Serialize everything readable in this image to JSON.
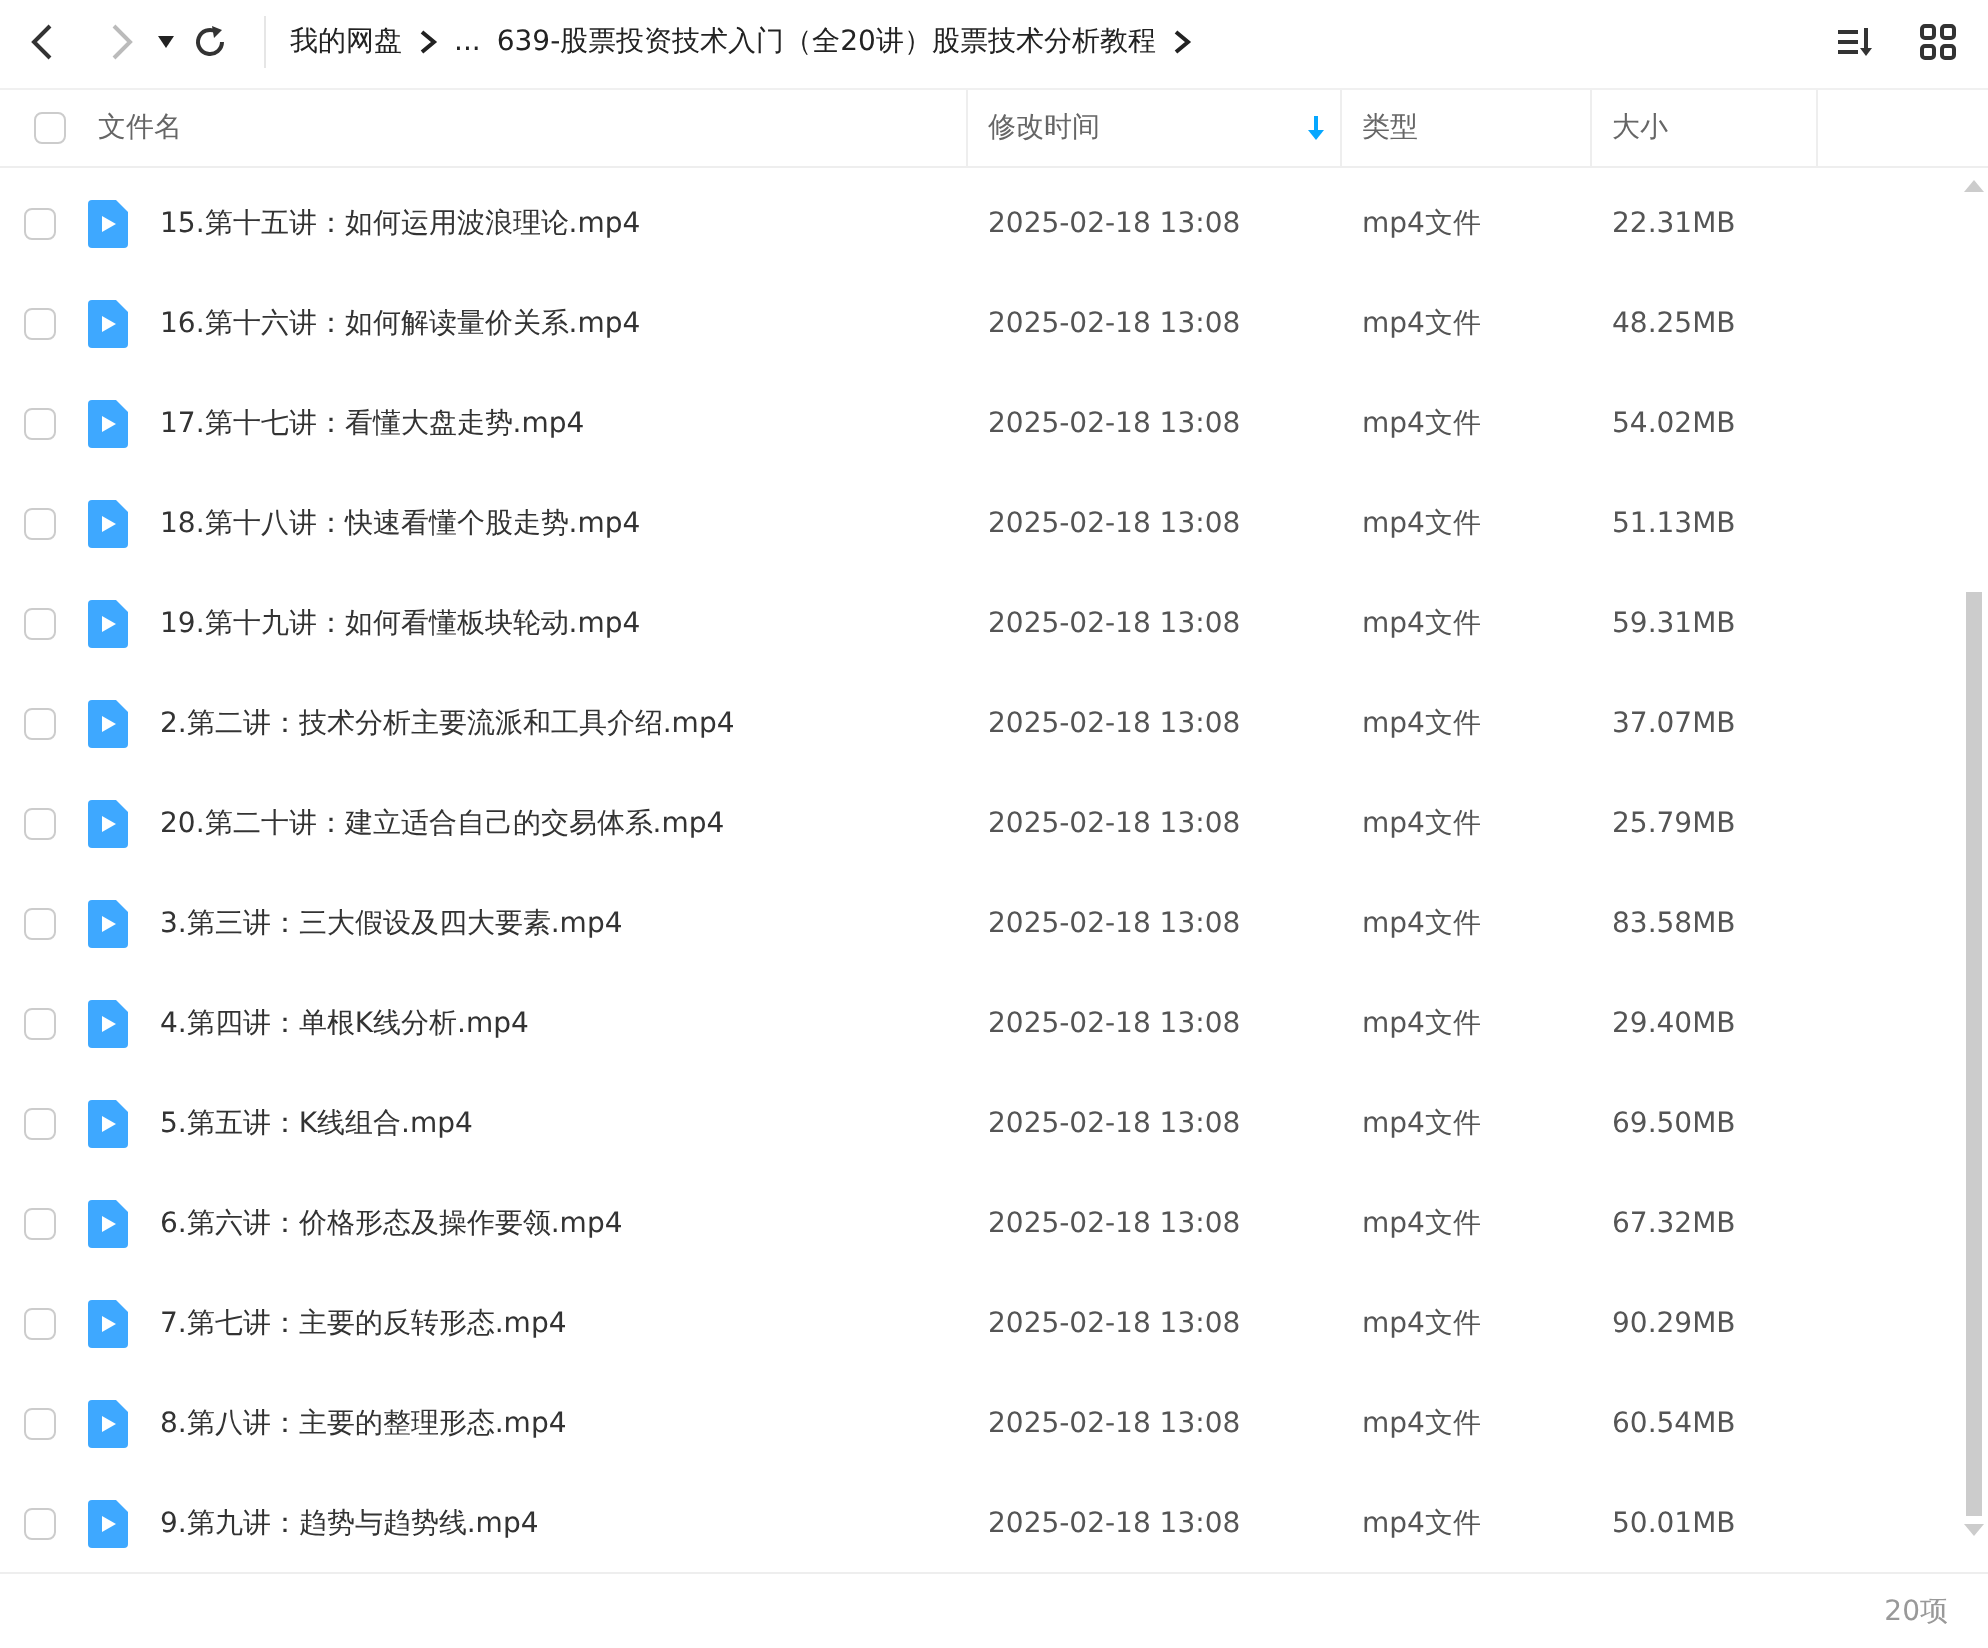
{
  "nav": {
    "back_disabled": false,
    "forward_disabled": true
  },
  "breadcrumb": [
    {
      "label": "我的网盘",
      "chevron": true
    },
    {
      "label": "...",
      "chevron": false
    },
    {
      "label": "639-股票投资技术入门（全20讲）股票技术分析教程",
      "chevron": true
    }
  ],
  "header": {
    "checked": false,
    "columns": [
      {
        "label": "文件名",
        "sorted": false
      },
      {
        "label": "修改时间",
        "sorted": true
      },
      {
        "label": "类型",
        "sorted": false
      },
      {
        "label": "大小",
        "sorted": false
      }
    ]
  },
  "rows": [
    {
      "name": "15.第十五讲：如何运用波浪理论.mp4",
      "modified": "2025-02-18 13:08",
      "type": "mp4文件",
      "size": "22.31MB",
      "checked": false
    },
    {
      "name": "16.第十六讲：如何解读量价关系.mp4",
      "modified": "2025-02-18 13:08",
      "type": "mp4文件",
      "size": "48.25MB",
      "checked": false
    },
    {
      "name": "17.第十七讲：看懂大盘走势.mp4",
      "modified": "2025-02-18 13:08",
      "type": "mp4文件",
      "size": "54.02MB",
      "checked": false
    },
    {
      "name": "18.第十八讲：快速看懂个股走势.mp4",
      "modified": "2025-02-18 13:08",
      "type": "mp4文件",
      "size": "51.13MB",
      "checked": false
    },
    {
      "name": "19.第十九讲：如何看懂板块轮动.mp4",
      "modified": "2025-02-18 13:08",
      "type": "mp4文件",
      "size": "59.31MB",
      "checked": false
    },
    {
      "name": "2.第二讲：技术分析主要流派和工具介绍.mp4",
      "modified": "2025-02-18 13:08",
      "type": "mp4文件",
      "size": "37.07MB",
      "checked": false
    },
    {
      "name": "20.第二十讲：建立适合自己的交易体系.mp4",
      "modified": "2025-02-18 13:08",
      "type": "mp4文件",
      "size": "25.79MB",
      "checked": false
    },
    {
      "name": "3.第三讲：三大假设及四大要素.mp4",
      "modified": "2025-02-18 13:08",
      "type": "mp4文件",
      "size": "83.58MB",
      "checked": false
    },
    {
      "name": "4.第四讲：单根K线分析.mp4",
      "modified": "2025-02-18 13:08",
      "type": "mp4文件",
      "size": "29.40MB",
      "checked": false
    },
    {
      "name": "5.第五讲：K线组合.mp4",
      "modified": "2025-02-18 13:08",
      "type": "mp4文件",
      "size": "69.50MB",
      "checked": false
    },
    {
      "name": "6.第六讲：价格形态及操作要领.mp4",
      "modified": "2025-02-18 13:08",
      "type": "mp4文件",
      "size": "67.32MB",
      "checked": false
    },
    {
      "name": "7.第七讲：主要的反转形态.mp4",
      "modified": "2025-02-18 13:08",
      "type": "mp4文件",
      "size": "90.29MB",
      "checked": false
    },
    {
      "name": "8.第八讲：主要的整理形态.mp4",
      "modified": "2025-02-18 13:08",
      "type": "mp4文件",
      "size": "60.54MB",
      "checked": false
    },
    {
      "name": "9.第九讲：趋势与趋势线.mp4",
      "modified": "2025-02-18 13:08",
      "type": "mp4文件",
      "size": "50.01MB",
      "checked": false
    }
  ],
  "status_bar": {
    "count": "20项"
  }
}
